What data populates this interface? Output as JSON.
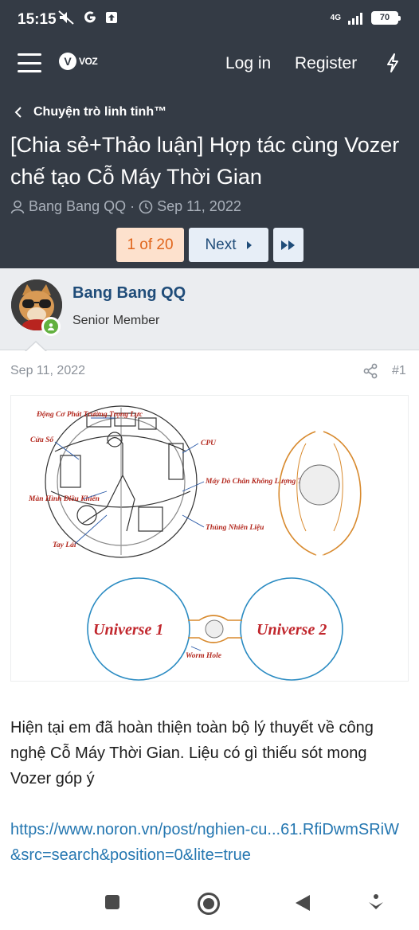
{
  "status_bar": {
    "time": "15:15",
    "icons": [
      "mute-icon",
      "google-icon",
      "upload-icon"
    ],
    "network": "4G",
    "battery": "70"
  },
  "nav": {
    "logo_text": "VOZ",
    "login": "Log in",
    "register": "Register"
  },
  "thread": {
    "breadcrumb": "Chuyện trò linh tinh™",
    "title": "[Chia sẻ+Thảo luận] Hợp tác cùng Vozer chế tạo Cỗ Máy Thời Gian",
    "author": "Bang Bang QQ",
    "date": "Sep 11, 2022",
    "separator": "·"
  },
  "pagination": {
    "current": "1 of 20",
    "next": "Next"
  },
  "post": {
    "username": "Bang Bang QQ",
    "user_title": "Senior Member",
    "date": "Sep 11, 2022",
    "number": "#1",
    "body": "Hiện tại em đã hoàn thiện toàn bộ lý thuyết về công nghệ Cỗ Máy Thời Gian. Liệu có gì thiếu sót mong Vozer góp ý",
    "link": "https://www.noron.vn/post/nghien-cu...61.RfiDwmSRiW&src=search&position=0&lite=true",
    "image": {
      "labels": {
        "engine": "Động Cơ Phát Trường Trọng Lực",
        "window": "Cửa Sổ",
        "cpu": "CPU",
        "screen": "Màn Hình Điều Khiển",
        "wheel": "Tay Lái",
        "detector": "Máy Dò Chân Không Lượng Tử",
        "fuel": "Thùng Nhiên Liệu",
        "universe1": "Universe 1",
        "universe2": "Universe 2",
        "wormhole": "Worm Hole"
      }
    }
  },
  "system_nav": [
    "recents-button",
    "home-button",
    "back-button",
    "assistant-button"
  ]
}
